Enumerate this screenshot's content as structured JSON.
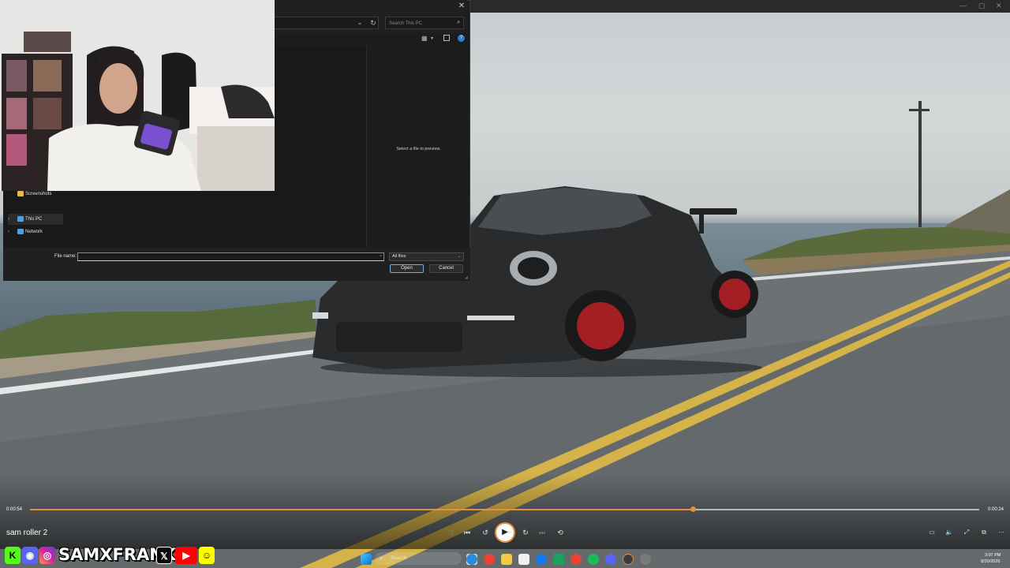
{
  "dialog": {
    "search_placeholder": "Search This PC",
    "preview_message": "Select a file to preview.",
    "nav": {
      "screenshots": "Screenshots",
      "this_pc": "This PC",
      "network": "Network"
    },
    "file_name_label": "File name:",
    "file_name_value": "",
    "file_type_filter": "All files",
    "open_label": "Open",
    "cancel_label": "Cancel",
    "close_glyph": "✕"
  },
  "player": {
    "media_title": "sam roller 2",
    "time_elapsed": "0:00:54",
    "time_remaining": "0:00:24",
    "progress_fraction": 0.698
  },
  "social": {
    "brand": "SAMXFRANK",
    "icons": [
      "kick-icon",
      "discord-icon",
      "instagram-icon",
      "x-icon",
      "youtube-icon",
      "snapchat-icon"
    ],
    "colors": {
      "kick": "#53fc18",
      "discord": "#5865f2",
      "instagram": "#d6249f",
      "x": "#000000",
      "youtube": "#ff0000",
      "snapchat": "#fffc00"
    }
  },
  "taskbar": {
    "search_label": "Search",
    "time": "3:07 PM",
    "date": "8/20/2026"
  },
  "colors": {
    "accent": "#e0903e",
    "dialog_bg": "#1c1c1c",
    "open_border": "#78aee6"
  }
}
